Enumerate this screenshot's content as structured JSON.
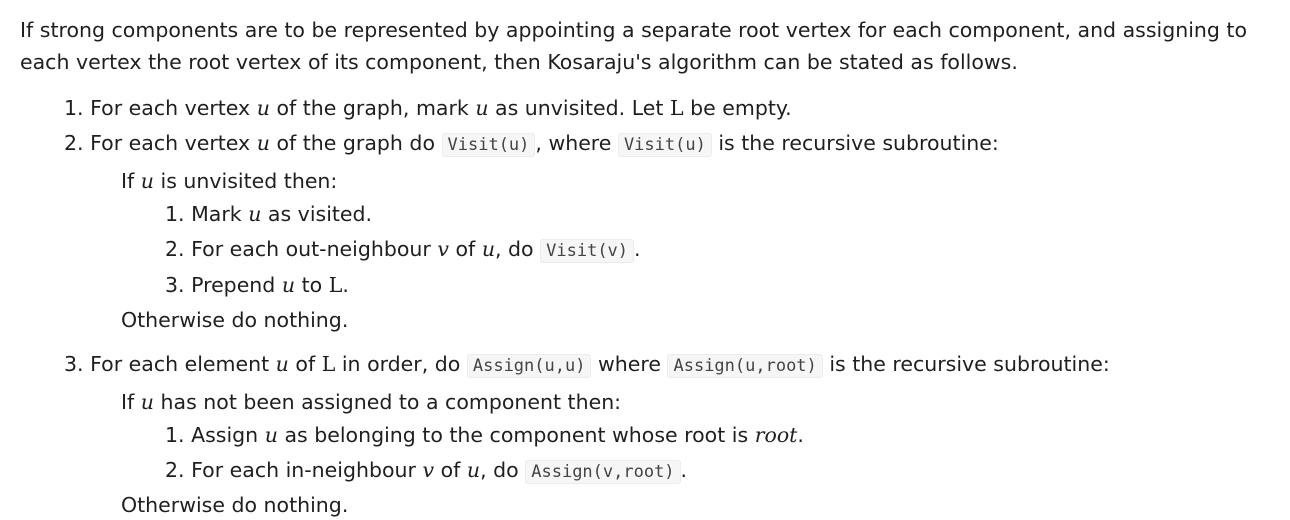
{
  "intro": "If strong components are to be represented by appointing a separate root vertex for each component, and assigning to each vertex the root vertex of its component, then Kosaraju's algorithm can be stated as follows.",
  "step1": {
    "num": "1.",
    "t1": "For each vertex",
    "u1": "u",
    "t2": "of the graph, mark",
    "u2": "u",
    "t3": "as unvisited. Let",
    "L": "L",
    "t4": "be empty."
  },
  "step2": {
    "num": "2.",
    "t1": "For each vertex",
    "u1": "u",
    "t2": "of the graph do",
    "code1": "Visit(u)",
    "t3": ", where",
    "code2": "Visit(u)",
    "t4": "is the recursive subroutine:",
    "cond_a": "If",
    "cond_u": "u",
    "cond_b": "is unvisited then:",
    "sub1": {
      "num": "1.",
      "a": "Mark",
      "u": "u",
      "b": "as visited."
    },
    "sub2": {
      "num": "2.",
      "a": "For each out-neighbour",
      "v": "v",
      "b": "of",
      "u": "u",
      "c": ", do",
      "code": "Visit(v)",
      "d": "."
    },
    "sub3": {
      "num": "3.",
      "a": "Prepend",
      "u": "u",
      "b": "to",
      "L": "L",
      "c": "."
    },
    "otherwise": "Otherwise do nothing."
  },
  "step3": {
    "num": "3.",
    "t1": "For each element",
    "u1": "u",
    "t2": "of",
    "L": "L",
    "t3": "in order, do",
    "code1": "Assign(u,u)",
    "t4": "where",
    "code2": "Assign(u,root)",
    "t5": "is the recursive subroutine:",
    "cond_a": "If",
    "cond_u": "u",
    "cond_b": "has not been assigned to a component then:",
    "sub1": {
      "num": "1.",
      "a": "Assign",
      "u": "u",
      "b": "as belonging to the component whose root is",
      "root": "root",
      "c": "."
    },
    "sub2": {
      "num": "2.",
      "a": "For each in-neighbour",
      "v": "v",
      "b": "of",
      "u": "u",
      "c": ", do",
      "code": "Assign(v,root)",
      "d": "."
    },
    "otherwise": "Otherwise do nothing."
  }
}
